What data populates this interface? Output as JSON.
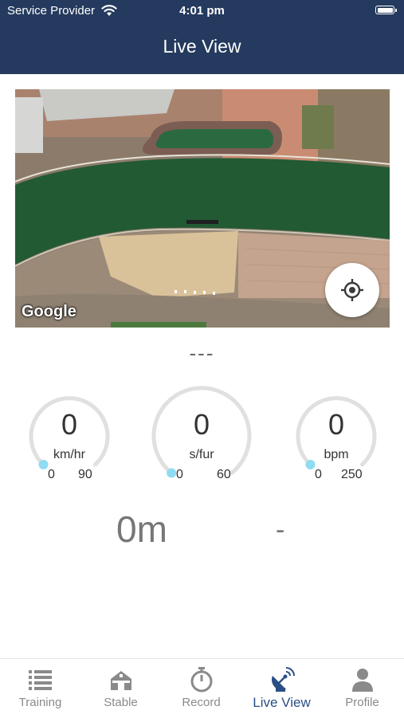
{
  "status_bar": {
    "carrier": "Service Provider",
    "time": "4:01 pm"
  },
  "header": {
    "title": "Live View"
  },
  "map": {
    "provider_label": "Google"
  },
  "horse_name": "---",
  "gauges": [
    {
      "value": "0",
      "unit": "km/hr",
      "min": "0",
      "max": "90",
      "progress": 0
    },
    {
      "value": "0",
      "unit": "s/fur",
      "min": "0",
      "max": "60",
      "progress": 0
    },
    {
      "value": "0",
      "unit": "bpm",
      "min": "0",
      "max": "250",
      "progress": 0
    }
  ],
  "distance": "0m",
  "lap_time": "-",
  "tabs": [
    {
      "label": "Training",
      "icon": "list-icon",
      "active": false
    },
    {
      "label": "Stable",
      "icon": "stable-icon",
      "active": false
    },
    {
      "label": "Record",
      "icon": "stopwatch-icon",
      "active": false
    },
    {
      "label": "Live View",
      "icon": "satellite-dish-icon",
      "active": true
    },
    {
      "label": "Profile",
      "icon": "person-icon",
      "active": false
    }
  ],
  "colors": {
    "header_bg": "#243a5e",
    "active_tab": "#2a4f86",
    "inactive_tab": "#8a8a8a",
    "gauge_track": "#e0e0e0",
    "gauge_knob": "#8fdcf3"
  }
}
